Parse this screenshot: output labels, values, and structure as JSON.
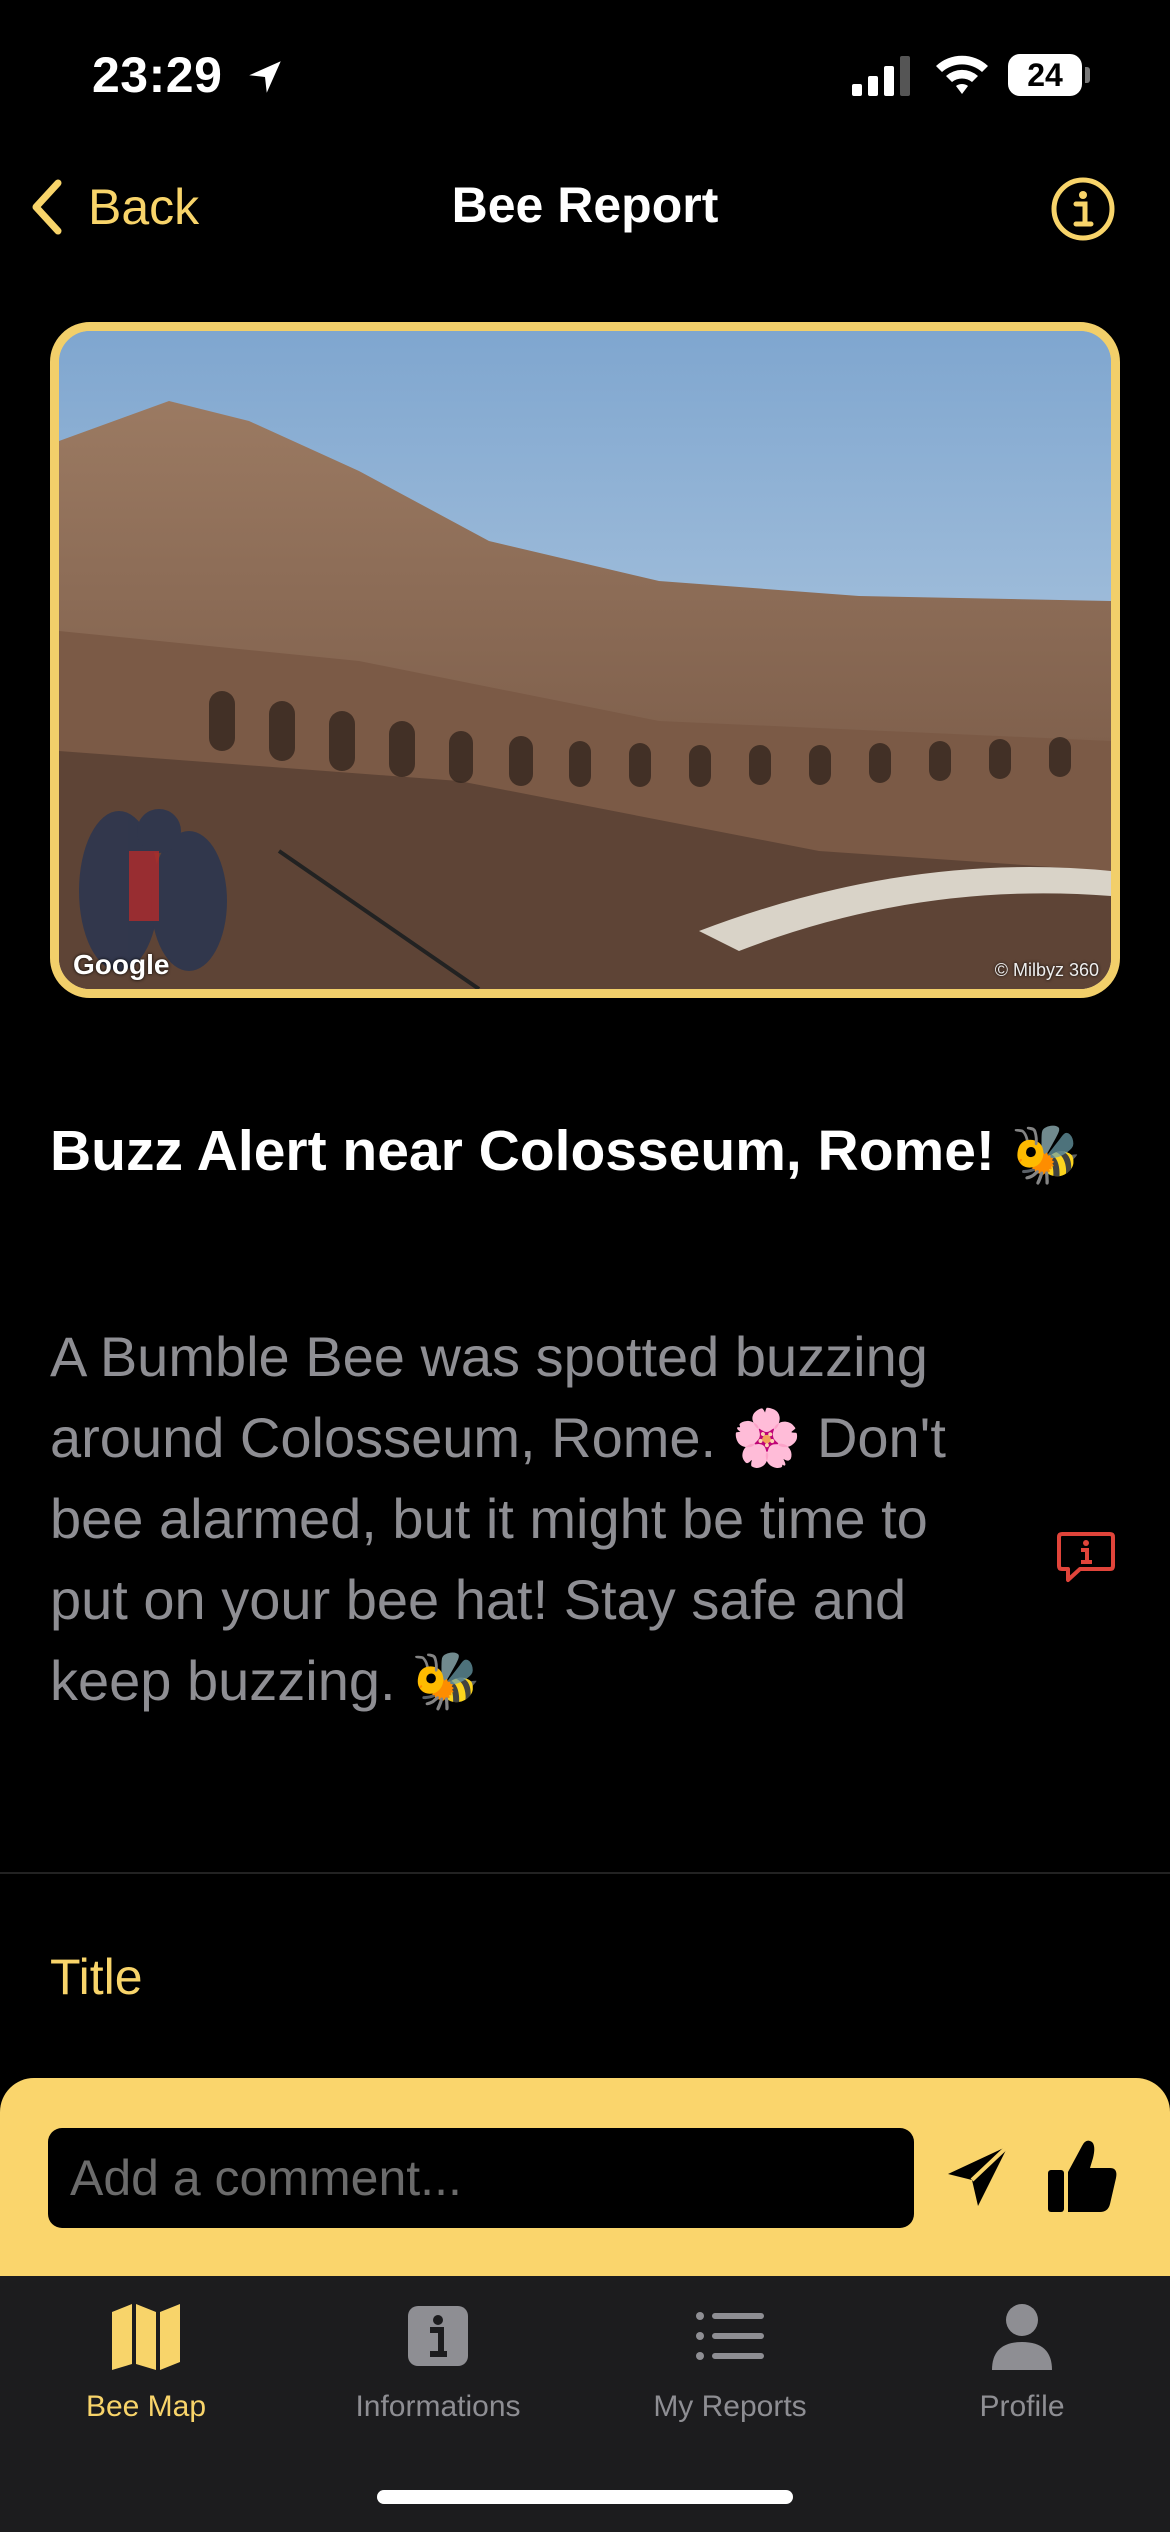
{
  "status_bar": {
    "time": "23:29",
    "battery": "24"
  },
  "nav": {
    "back_label": "Back",
    "title": "Bee Report"
  },
  "photo": {
    "watermark": "Google",
    "credit": "© Milbyz 360"
  },
  "report": {
    "title": "Buzz Alert near Colosseum, Rome!",
    "title_emoji": "🐝",
    "body": "A Bumble Bee was spotted buzzing around Colosseum, Rome. 🌸 Don't bee alarmed, but it might be time to put on your bee hat! Stay safe and keep buzzing. 🐝"
  },
  "section": {
    "title": "Title"
  },
  "comment": {
    "placeholder": "Add a comment..."
  },
  "tabs": [
    {
      "label": "Bee Map",
      "icon": "map-icon",
      "active": true
    },
    {
      "label": "Informations",
      "icon": "info-icon",
      "active": false
    },
    {
      "label": "My Reports",
      "icon": "list-icon",
      "active": false
    },
    {
      "label": "Profile",
      "icon": "person-icon",
      "active": false
    }
  ],
  "colors": {
    "accent": "#f8d46a",
    "comment_bar": "#fad56c",
    "report_icon": "#e0443a",
    "background": "#000000"
  }
}
